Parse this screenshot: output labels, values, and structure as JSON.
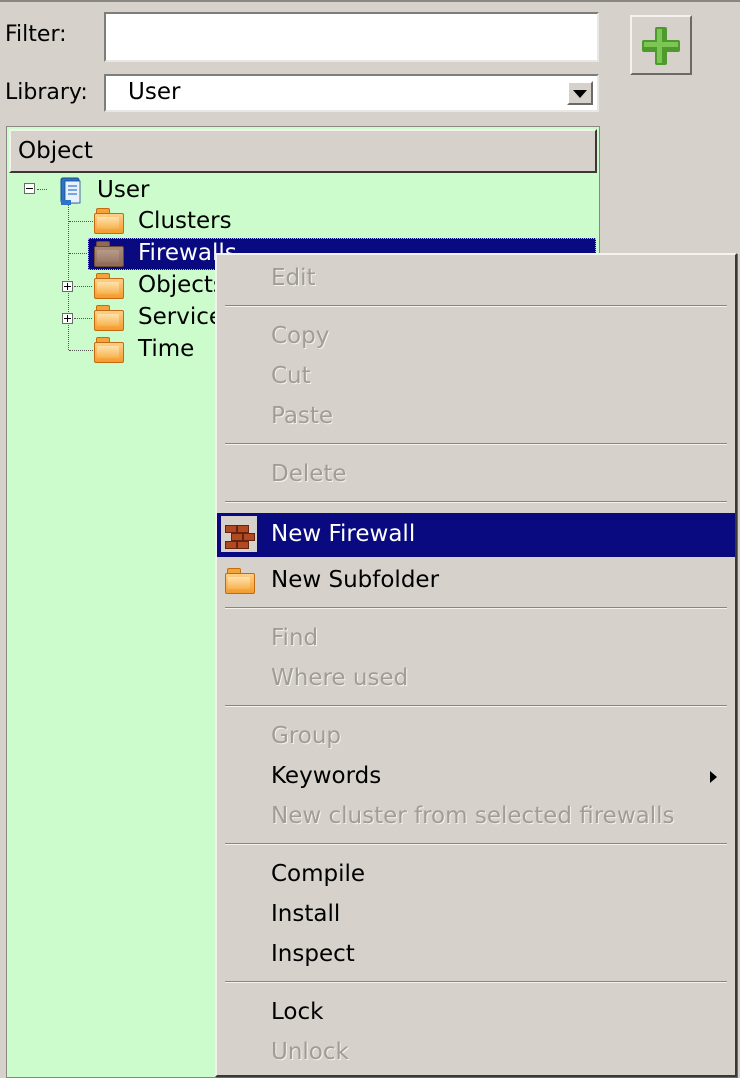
{
  "filter": {
    "label": "Filter:",
    "value": "",
    "placeholder": ""
  },
  "library": {
    "label": "Library:",
    "selected": "User"
  },
  "add_button": {
    "icon": "plus-icon",
    "color": "#4e9a2e"
  },
  "tree": {
    "header": "Object",
    "root": {
      "label": "User",
      "icon": "library-book-icon"
    },
    "items": [
      {
        "label": "Clusters",
        "expandable": false
      },
      {
        "label": "Firewalls",
        "expandable": false,
        "selected": true
      },
      {
        "label": "Objects",
        "expandable": true
      },
      {
        "label": "Services",
        "expandable": true
      },
      {
        "label": "Time",
        "expandable": false
      }
    ],
    "background": "#ccfccc",
    "selection_color": "#0a0a80"
  },
  "context_menu": {
    "edit": "Edit",
    "copy": "Copy",
    "cut": "Cut",
    "paste": "Paste",
    "delete": "Delete",
    "new_firewall": "New Firewall",
    "new_subfolder": "New Subfolder",
    "find": "Find",
    "where_used": "Where used",
    "group": "Group",
    "keywords": "Keywords",
    "new_cluster": "New cluster from selected firewalls",
    "compile": "Compile",
    "install": "Install",
    "inspect": "Inspect",
    "lock": "Lock",
    "unlock": "Unlock"
  }
}
